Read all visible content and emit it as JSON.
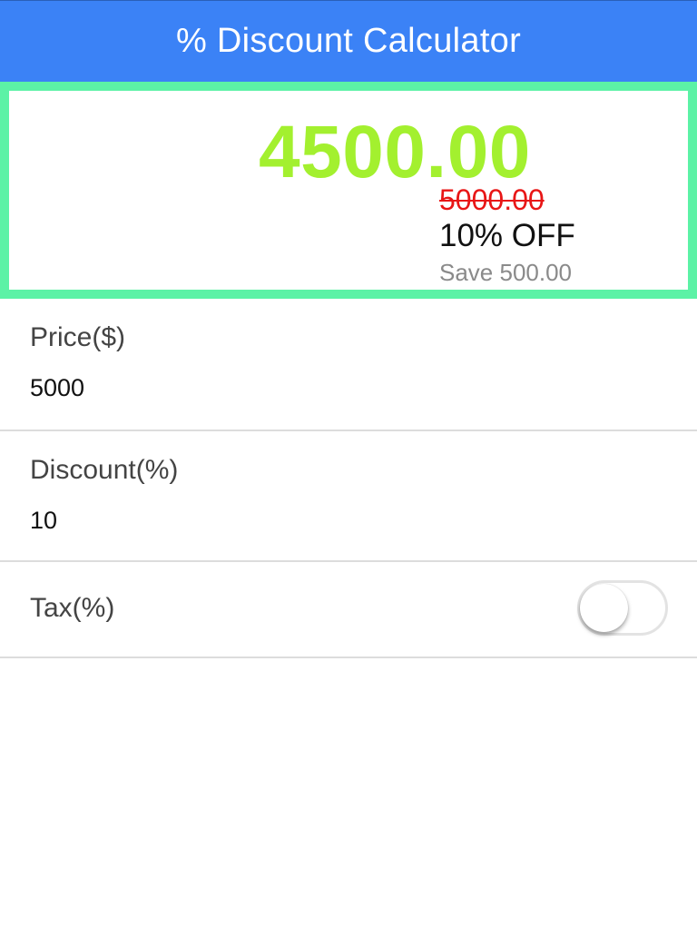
{
  "app": {
    "title": "% Discount Calculator"
  },
  "result": {
    "final_price": "4500.00",
    "original_price": "5000.00",
    "discount_label": "10% OFF",
    "savings_text": "Save 500.00"
  },
  "form": {
    "price": {
      "label": "Price($)",
      "value": "5000"
    },
    "discount": {
      "label": "Discount(%)",
      "value": "10"
    },
    "tax": {
      "label": "Tax(%)",
      "enabled": false
    }
  },
  "colors": {
    "app_bar": "#3b82f6",
    "panel_border": "#5cf2a6",
    "final_price": "#a3f02f",
    "original_price": "#e81616",
    "savings_text": "#8a8a8a"
  }
}
